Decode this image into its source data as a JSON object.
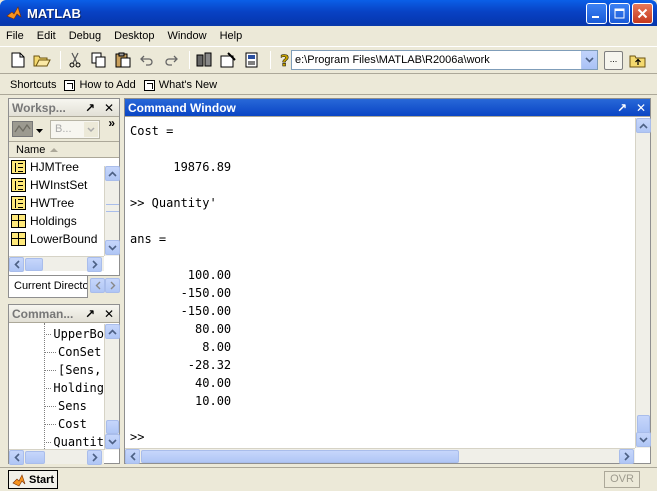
{
  "window": {
    "title": "MATLAB"
  },
  "menu": [
    "File",
    "Edit",
    "Debug",
    "Desktop",
    "Window",
    "Help"
  ],
  "toolbar": {
    "current_directory": "e:\\Program Files\\MATLAB\\R2006a\\work",
    "browse_label": "..."
  },
  "shortcuts": {
    "label": "Shortcuts",
    "items": [
      "How to Add",
      "What's New"
    ]
  },
  "workspace": {
    "title": "Worksp...",
    "dock": "↗",
    "close": "✕",
    "base_label": "B...",
    "more": "»",
    "column_name": "Name",
    "rows": [
      {
        "name": "HJMTree",
        "icon": "tree"
      },
      {
        "name": "HWInstSet",
        "icon": "tree"
      },
      {
        "name": "HWTree",
        "icon": "tree"
      },
      {
        "name": "Holdings",
        "icon": "grid"
      },
      {
        "name": "LowerBound",
        "icon": "grid"
      }
    ],
    "tab_label": "Current Directo"
  },
  "history": {
    "title": "Comman...",
    "dock": "↗",
    "close": "✕",
    "lines": [
      "UpperBo",
      "ConSet",
      "[Sens,",
      "Holding",
      "Sens",
      "Cost",
      "Quantit"
    ]
  },
  "command_window": {
    "title": "Command Window",
    "dock": "↗",
    "close": "✕",
    "content": "Cost =\n\n      19876.89\n\n>> Quantity'\n\nans =\n\n        100.00\n       -150.00\n       -150.00\n         80.00\n          8.00\n        -28.32\n         40.00\n         10.00\n\n>>"
  },
  "status": {
    "start_label": "Start",
    "ovr_label": "OVR"
  },
  "colors": {
    "title_blue": "#0842c4",
    "face": "#ece9d8"
  }
}
